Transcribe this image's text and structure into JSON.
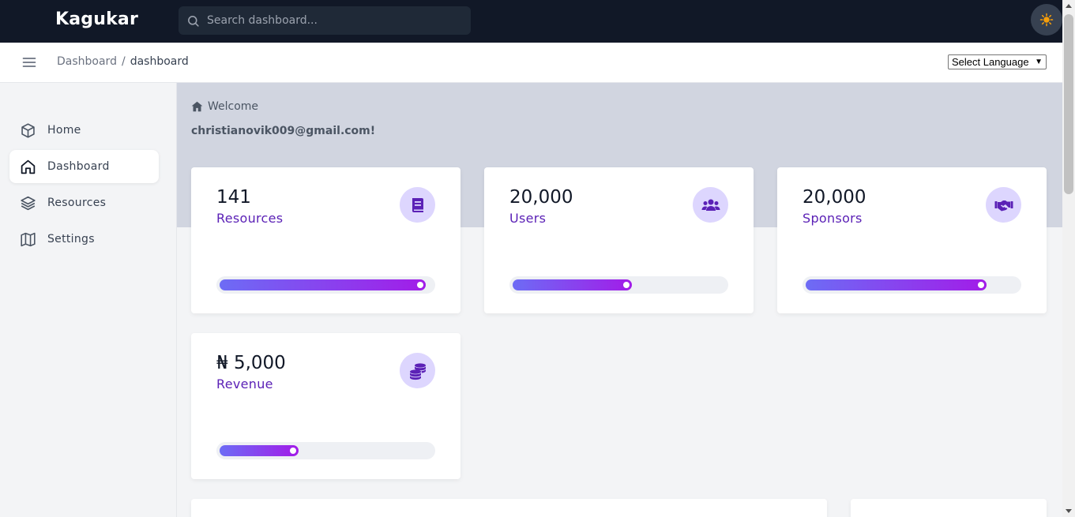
{
  "app": {
    "brand": "Kagukar"
  },
  "search": {
    "placeholder": "Search dashboard..."
  },
  "breadcrumb": {
    "root": "Dashboard",
    "separator": "/",
    "current": "dashboard"
  },
  "language": {
    "selected": "Select Language"
  },
  "sidebar": {
    "items": [
      {
        "label": "Home",
        "icon": "cube-icon",
        "active": false
      },
      {
        "label": "Dashboard",
        "icon": "home-icon",
        "active": true
      },
      {
        "label": "Resources",
        "icon": "layers-icon",
        "active": false
      },
      {
        "label": "Settings",
        "icon": "map-icon",
        "active": false
      }
    ]
  },
  "welcome": {
    "label": "Welcome",
    "email": "christianovik009@gmail.com!"
  },
  "stats": [
    {
      "value": "141",
      "label": "Resources",
      "icon": "book-icon",
      "progress": 0.97
    },
    {
      "value": "20,000",
      "label": "Users",
      "icon": "users-icon",
      "progress": 0.56
    },
    {
      "value": "20,000",
      "label": "Sponsors",
      "icon": "handshake-icon",
      "progress": 0.85
    },
    {
      "value": "₦ 5,000",
      "label": "Revenue",
      "icon": "coins-icon",
      "progress": 0.37
    }
  ],
  "colors": {
    "topbar": "#111827",
    "accent": "#5b21b6",
    "icon_bg": "#ddd6fe",
    "gradient_start": "#6d6cf5",
    "gradient_end": "#a21ce8"
  }
}
